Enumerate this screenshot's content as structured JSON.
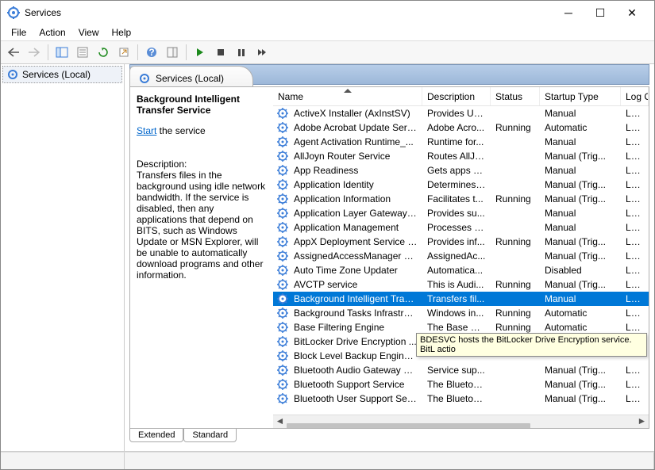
{
  "window": {
    "title": "Services"
  },
  "menus": [
    "File",
    "Action",
    "View",
    "Help"
  ],
  "left": {
    "item": "Services (Local)"
  },
  "tab": {
    "label": "Services (Local)"
  },
  "detail": {
    "title": "Background Intelligent Transfer Service",
    "link": "Start",
    "link_after": " the service",
    "desc_h": "Description:",
    "desc": "Transfers files in the background using idle network bandwidth. If the service is disabled, then any applications that depend on BITS, such as Windows Update or MSN Explorer, will be unable to automatically download programs and other information."
  },
  "columns": {
    "name": "Name",
    "desc": "Description",
    "status": "Status",
    "startup": "Startup Type",
    "logon": "Log On"
  },
  "rows": [
    {
      "name": "ActiveX Installer (AxInstSV)",
      "desc": "Provides Us...",
      "status": "",
      "startup": "Manual",
      "logon": "Local Sy"
    },
    {
      "name": "Adobe Acrobat Update Serv...",
      "desc": "Adobe Acro...",
      "status": "Running",
      "startup": "Automatic",
      "logon": "Local Sy"
    },
    {
      "name": "Agent Activation Runtime_...",
      "desc": "Runtime for...",
      "status": "",
      "startup": "Manual",
      "logon": "Local Sy"
    },
    {
      "name": "AllJoyn Router Service",
      "desc": "Routes AllJo...",
      "status": "",
      "startup": "Manual (Trig...",
      "logon": "Local Se"
    },
    {
      "name": "App Readiness",
      "desc": "Gets apps re...",
      "status": "",
      "startup": "Manual",
      "logon": "Local Sy"
    },
    {
      "name": "Application Identity",
      "desc": "Determines ...",
      "status": "",
      "startup": "Manual (Trig...",
      "logon": "Local Se"
    },
    {
      "name": "Application Information",
      "desc": "Facilitates t...",
      "status": "Running",
      "startup": "Manual (Trig...",
      "logon": "Local Sy"
    },
    {
      "name": "Application Layer Gateway ...",
      "desc": "Provides su...",
      "status": "",
      "startup": "Manual",
      "logon": "Local Se"
    },
    {
      "name": "Application Management",
      "desc": "Processes in...",
      "status": "",
      "startup": "Manual",
      "logon": "Local Sy"
    },
    {
      "name": "AppX Deployment Service (...",
      "desc": "Provides inf...",
      "status": "Running",
      "startup": "Manual (Trig...",
      "logon": "Local Sy"
    },
    {
      "name": "AssignedAccessManager Se...",
      "desc": "AssignedAc...",
      "status": "",
      "startup": "Manual (Trig...",
      "logon": "Local Sy"
    },
    {
      "name": "Auto Time Zone Updater",
      "desc": "Automatica...",
      "status": "",
      "startup": "Disabled",
      "logon": "Local Se"
    },
    {
      "name": "AVCTP service",
      "desc": "This is Audi...",
      "status": "Running",
      "startup": "Manual (Trig...",
      "logon": "Local Se"
    },
    {
      "name": "Background Intelligent Tran...",
      "desc": "Transfers fil...",
      "status": "",
      "startup": "Manual",
      "logon": "Local Sy",
      "selected": true
    },
    {
      "name": "Background Tasks Infrastruc...",
      "desc": "Windows in...",
      "status": "Running",
      "startup": "Automatic",
      "logon": "Local Sy"
    },
    {
      "name": "Base Filtering Engine",
      "desc": "The Base Fil...",
      "status": "Running",
      "startup": "Automatic",
      "logon": "Local Se"
    },
    {
      "name": "BitLocker Drive Encryption ...",
      "desc": "",
      "status": "",
      "startup": "",
      "logon": ""
    },
    {
      "name": "Block Level Backup Engine ...",
      "desc": "",
      "status": "",
      "startup": "",
      "logon": ""
    },
    {
      "name": "Bluetooth Audio Gateway S...",
      "desc": "Service sup...",
      "status": "",
      "startup": "Manual (Trig...",
      "logon": "Local Se"
    },
    {
      "name": "Bluetooth Support Service",
      "desc": "The Bluetoo...",
      "status": "",
      "startup": "Manual (Trig...",
      "logon": "Local Se"
    },
    {
      "name": "Bluetooth User Support Ser...",
      "desc": "The Bluetoo...",
      "status": "",
      "startup": "Manual (Trig...",
      "logon": "Local Sy"
    }
  ],
  "tooltip": "BDESVC hosts the BitLocker Drive Encryption service. BitL actio",
  "tabs_bottom": {
    "extended": "Extended",
    "standard": "Standard"
  }
}
